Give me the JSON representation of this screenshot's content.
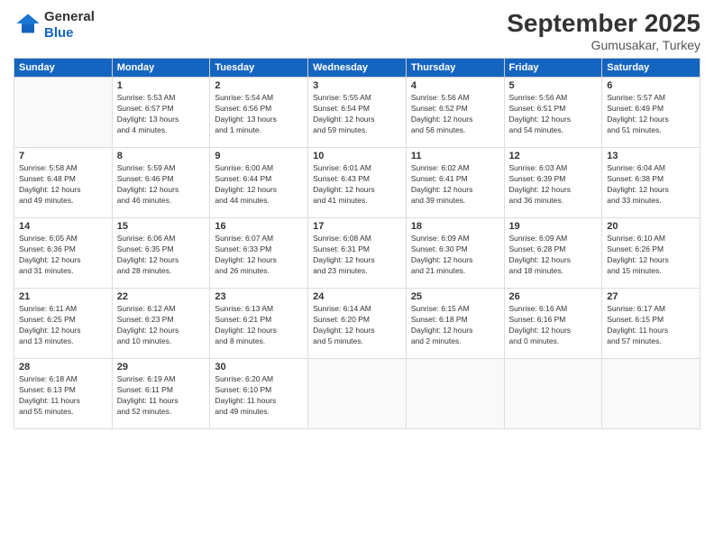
{
  "logo": {
    "line1": "General",
    "line2": "Blue"
  },
  "header": {
    "month_year": "September 2025",
    "location": "Gumusakar, Turkey"
  },
  "days_of_week": [
    "Sunday",
    "Monday",
    "Tuesday",
    "Wednesday",
    "Thursday",
    "Friday",
    "Saturday"
  ],
  "weeks": [
    [
      {
        "day": "",
        "info": ""
      },
      {
        "day": "1",
        "info": "Sunrise: 5:53 AM\nSunset: 6:57 PM\nDaylight: 13 hours\nand 4 minutes."
      },
      {
        "day": "2",
        "info": "Sunrise: 5:54 AM\nSunset: 6:56 PM\nDaylight: 13 hours\nand 1 minute."
      },
      {
        "day": "3",
        "info": "Sunrise: 5:55 AM\nSunset: 6:54 PM\nDaylight: 12 hours\nand 59 minutes."
      },
      {
        "day": "4",
        "info": "Sunrise: 5:56 AM\nSunset: 6:52 PM\nDaylight: 12 hours\nand 56 minutes."
      },
      {
        "day": "5",
        "info": "Sunrise: 5:56 AM\nSunset: 6:51 PM\nDaylight: 12 hours\nand 54 minutes."
      },
      {
        "day": "6",
        "info": "Sunrise: 5:57 AM\nSunset: 6:49 PM\nDaylight: 12 hours\nand 51 minutes."
      }
    ],
    [
      {
        "day": "7",
        "info": "Sunrise: 5:58 AM\nSunset: 6:48 PM\nDaylight: 12 hours\nand 49 minutes."
      },
      {
        "day": "8",
        "info": "Sunrise: 5:59 AM\nSunset: 6:46 PM\nDaylight: 12 hours\nand 46 minutes."
      },
      {
        "day": "9",
        "info": "Sunrise: 6:00 AM\nSunset: 6:44 PM\nDaylight: 12 hours\nand 44 minutes."
      },
      {
        "day": "10",
        "info": "Sunrise: 6:01 AM\nSunset: 6:43 PM\nDaylight: 12 hours\nand 41 minutes."
      },
      {
        "day": "11",
        "info": "Sunrise: 6:02 AM\nSunset: 6:41 PM\nDaylight: 12 hours\nand 39 minutes."
      },
      {
        "day": "12",
        "info": "Sunrise: 6:03 AM\nSunset: 6:39 PM\nDaylight: 12 hours\nand 36 minutes."
      },
      {
        "day": "13",
        "info": "Sunrise: 6:04 AM\nSunset: 6:38 PM\nDaylight: 12 hours\nand 33 minutes."
      }
    ],
    [
      {
        "day": "14",
        "info": "Sunrise: 6:05 AM\nSunset: 6:36 PM\nDaylight: 12 hours\nand 31 minutes."
      },
      {
        "day": "15",
        "info": "Sunrise: 6:06 AM\nSunset: 6:35 PM\nDaylight: 12 hours\nand 28 minutes."
      },
      {
        "day": "16",
        "info": "Sunrise: 6:07 AM\nSunset: 6:33 PM\nDaylight: 12 hours\nand 26 minutes."
      },
      {
        "day": "17",
        "info": "Sunrise: 6:08 AM\nSunset: 6:31 PM\nDaylight: 12 hours\nand 23 minutes."
      },
      {
        "day": "18",
        "info": "Sunrise: 6:09 AM\nSunset: 6:30 PM\nDaylight: 12 hours\nand 21 minutes."
      },
      {
        "day": "19",
        "info": "Sunrise: 6:09 AM\nSunset: 6:28 PM\nDaylight: 12 hours\nand 18 minutes."
      },
      {
        "day": "20",
        "info": "Sunrise: 6:10 AM\nSunset: 6:26 PM\nDaylight: 12 hours\nand 15 minutes."
      }
    ],
    [
      {
        "day": "21",
        "info": "Sunrise: 6:11 AM\nSunset: 6:25 PM\nDaylight: 12 hours\nand 13 minutes."
      },
      {
        "day": "22",
        "info": "Sunrise: 6:12 AM\nSunset: 6:23 PM\nDaylight: 12 hours\nand 10 minutes."
      },
      {
        "day": "23",
        "info": "Sunrise: 6:13 AM\nSunset: 6:21 PM\nDaylight: 12 hours\nand 8 minutes."
      },
      {
        "day": "24",
        "info": "Sunrise: 6:14 AM\nSunset: 6:20 PM\nDaylight: 12 hours\nand 5 minutes."
      },
      {
        "day": "25",
        "info": "Sunrise: 6:15 AM\nSunset: 6:18 PM\nDaylight: 12 hours\nand 2 minutes."
      },
      {
        "day": "26",
        "info": "Sunrise: 6:16 AM\nSunset: 6:16 PM\nDaylight: 12 hours\nand 0 minutes."
      },
      {
        "day": "27",
        "info": "Sunrise: 6:17 AM\nSunset: 6:15 PM\nDaylight: 11 hours\nand 57 minutes."
      }
    ],
    [
      {
        "day": "28",
        "info": "Sunrise: 6:18 AM\nSunset: 6:13 PM\nDaylight: 11 hours\nand 55 minutes."
      },
      {
        "day": "29",
        "info": "Sunrise: 6:19 AM\nSunset: 6:11 PM\nDaylight: 11 hours\nand 52 minutes."
      },
      {
        "day": "30",
        "info": "Sunrise: 6:20 AM\nSunset: 6:10 PM\nDaylight: 11 hours\nand 49 minutes."
      },
      {
        "day": "",
        "info": ""
      },
      {
        "day": "",
        "info": ""
      },
      {
        "day": "",
        "info": ""
      },
      {
        "day": "",
        "info": ""
      }
    ]
  ]
}
